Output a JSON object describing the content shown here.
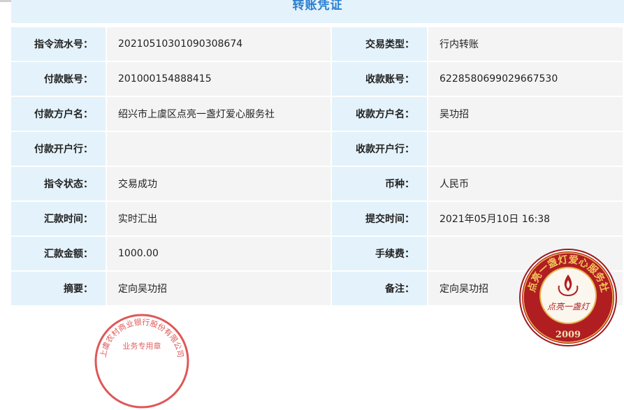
{
  "title": "转账凭证",
  "rows": [
    {
      "l1": "指令流水号：",
      "v1": "20210510301090308674",
      "l2": "交易类型：",
      "v2": "行内转账"
    },
    {
      "l1": "付款账号：",
      "v1": "201000154888415",
      "l2": "收款账号：",
      "v2": "6228580699029667530"
    },
    {
      "l1": "付款方户名：",
      "v1": "绍兴市上虞区点亮一盏灯爱心服务社",
      "l2": "收款方户名：",
      "v2": "吴功招"
    },
    {
      "l1": "付款开户行：",
      "v1": "",
      "l2": "收款开户行：",
      "v2": ""
    },
    {
      "l1": "指令状态：",
      "v1": "交易成功",
      "l2": "币种：",
      "v2": "人民币"
    },
    {
      "l1": "汇款时间：",
      "v1": "实时汇出",
      "l2": "提交时间：",
      "v2": "2021年05月10日 16:38"
    },
    {
      "l1": "汇款金额：",
      "v1": "1000.00",
      "l2": "手续费：",
      "v2": ""
    },
    {
      "l1": "摘要：",
      "v1": "定向吴功招",
      "l2": "备注：",
      "v2": "定向吴功招"
    }
  ],
  "seals": {
    "bank": {
      "text": "上虞农村商业银行股份有限公司",
      "sub": "业务专用章",
      "color": "#d93a3a"
    },
    "org": {
      "ring_text": "点亮一盏灯爱心服务社",
      "center": "点亮一盏灯",
      "year": "2009",
      "color": "#b01e22",
      "gold": "#e8b24a"
    }
  }
}
